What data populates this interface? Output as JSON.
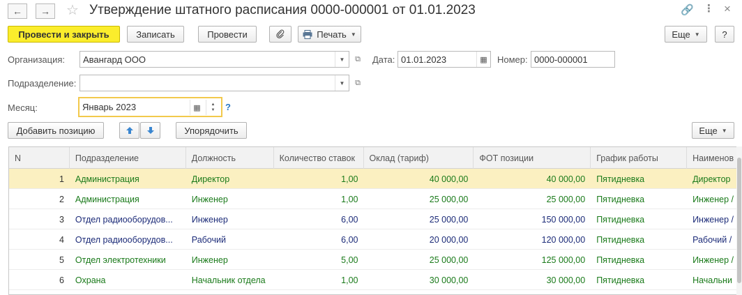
{
  "window": {
    "title": "Утверждение штатного расписания 0000-000001 от 01.01.2023",
    "back_icon": "arrow-left-icon",
    "forward_icon": "arrow-right-icon",
    "favorite_icon": "star-icon",
    "link_icon": "link-icon",
    "menu_icon": "kebab-menu-icon",
    "close_icon": "close-icon"
  },
  "toolbar": {
    "post_close": "Провести и закрыть",
    "save": "Записать",
    "post": "Провести",
    "attach_icon": "paperclip-icon",
    "print": "Печать",
    "more": "Еще",
    "help": "?"
  },
  "form": {
    "org_label": "Организация:",
    "org_value": "Авангард ООО",
    "date_label": "Дата:",
    "date_value": "01.01.2023",
    "number_label": "Номер:",
    "number_value": "0000-000001",
    "division_label": "Подразделение:",
    "division_value": "",
    "month_label": "Месяц:",
    "month_value": "Январь 2023",
    "month_help": "?"
  },
  "table_toolbar": {
    "add_position": "Добавить позицию",
    "up_icon": "arrow-up-icon",
    "down_icon": "arrow-down-icon",
    "sort": "Упорядочить",
    "more": "Еще"
  },
  "table": {
    "columns": [
      "N",
      "Подразделение",
      "Должность",
      "Количество ставок",
      "Оклад (тариф)",
      "ФОТ  позиции",
      "График работы",
      "Наименов"
    ],
    "rows": [
      {
        "n": "1",
        "division": "Администрация",
        "position": "Директор",
        "rates": "1,00",
        "salary": "40 000,00",
        "fot": "40 000,00",
        "schedule": "Пятидневка",
        "name": "Директор"
      },
      {
        "n": "2",
        "division": "Администрация",
        "position": "Инженер",
        "rates": "1,00",
        "salary": "25 000,00",
        "fot": "25 000,00",
        "schedule": "Пятидневка",
        "name": "Инженер /"
      },
      {
        "n": "3",
        "division": "Отдел радиооборудов...",
        "position": "Инженер",
        "rates": "6,00",
        "salary": "25 000,00",
        "fot": "150 000,00",
        "schedule": "Пятидневка",
        "name": "Инженер /"
      },
      {
        "n": "4",
        "division": "Отдел радиооборудов...",
        "position": "Рабочий",
        "rates": "6,00",
        "salary": "20 000,00",
        "fot": "120 000,00",
        "schedule": "Пятидневка",
        "name": "Рабочий /"
      },
      {
        "n": "5",
        "division": "Отдел электротехники",
        "position": "Инженер",
        "rates": "5,00",
        "salary": "25 000,00",
        "fot": "125 000,00",
        "schedule": "Пятидневка",
        "name": "Инженер /"
      },
      {
        "n": "6",
        "division": "Охрана",
        "position": "Начальник отдела",
        "rates": "1,00",
        "salary": "30 000,00",
        "fot": "30 000,00",
        "schedule": "Пятидневка",
        "name": "Начальни"
      }
    ],
    "selected_row": "1"
  }
}
